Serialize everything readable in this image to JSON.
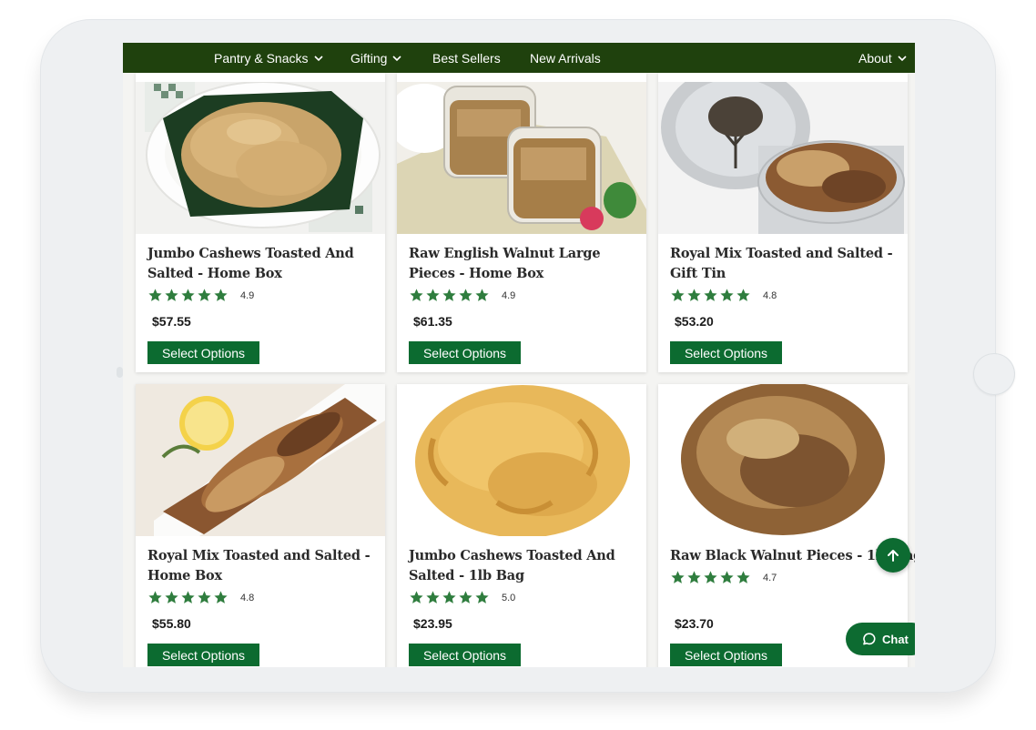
{
  "nav": {
    "items": [
      {
        "label": "Pantry & Snacks",
        "has_dropdown": true
      },
      {
        "label": "Gifting",
        "has_dropdown": true
      },
      {
        "label": "Best Sellers",
        "has_dropdown": false
      },
      {
        "label": "New Arrivals",
        "has_dropdown": false
      }
    ],
    "about": {
      "label": "About",
      "has_dropdown": true
    }
  },
  "products": [
    {
      "title": "Jumbo Cashews Toasted And Salted - Home Box",
      "rating": "4.9",
      "stars": 5,
      "price": "$57.55",
      "button": "Select Options",
      "image": "cashews-in-bowl"
    },
    {
      "title": "Raw English Walnut Large Pieces - Home Box",
      "rating": "4.9",
      "stars": 5,
      "price": "$61.35",
      "button": "Select Options",
      "image": "walnuts-in-jars"
    },
    {
      "title": "Royal Mix Toasted and Salted - Gift Tin",
      "rating": "4.8",
      "stars": 5,
      "price": "$53.20",
      "button": "Select Options",
      "image": "mixed-nuts-tin"
    },
    {
      "title": "Royal Mix Toasted and Salted - Home Box",
      "rating": "4.8",
      "stars": 5,
      "price": "$55.80",
      "button": "Select Options",
      "image": "mixed-nuts-platter"
    },
    {
      "title": "Jumbo Cashews Toasted And Salted - 1lb Bag",
      "rating": "5.0",
      "stars": 5,
      "price": "$23.95",
      "button": "Select Options",
      "image": "cashews-pile"
    },
    {
      "title": "Raw Black Walnut Pieces - 1lb Bag",
      "rating": "4.7",
      "stars": 5,
      "price": "$23.70",
      "button": "Select Options",
      "image": "black-walnut-pieces"
    }
  ],
  "chat": {
    "label": "Chat"
  },
  "colors": {
    "nav_bg": "#1f410d",
    "accent_green": "#0c6b30",
    "star_green": "#2f7d3e"
  },
  "icons": {
    "scroll_top": "arrow-up-icon",
    "chat": "chat-bubble-icon",
    "dropdown": "chevron-down-icon",
    "rating": "star-icon"
  }
}
